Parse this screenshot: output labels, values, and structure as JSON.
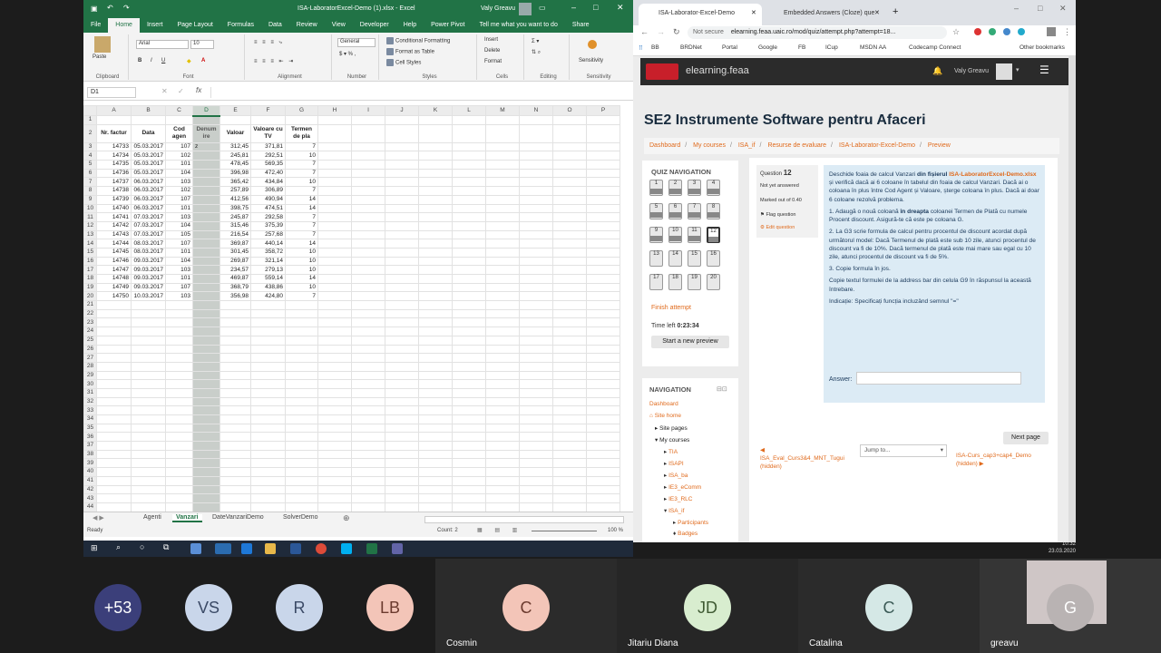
{
  "excel": {
    "title": "ISA-LaboratorExcel-Demo (1).xlsx - Excel",
    "user": "Valy Greavu",
    "tabs": [
      "File",
      "Home",
      "Insert",
      "Page Layout",
      "Formulas",
      "Data",
      "Review",
      "View",
      "Developer",
      "Help",
      "Power Pivot",
      "Tell me what you want to do",
      "Share"
    ],
    "ribbon": {
      "paste": "Paste",
      "clipboard": "Clipboard",
      "font_name": "Arial",
      "font_size": "10",
      "font": "Font",
      "alignment": "Alignment",
      "number_format": "General",
      "number": "Number",
      "cond_fmt": "Conditional Formatting",
      "fmt_table": "Format as Table",
      "cell_styles": "Cell Styles",
      "styles": "Styles",
      "insert": "Insert",
      "delete": "Delete",
      "format": "Format",
      "cells": "Cells",
      "editing": "Editing",
      "sensitivity": "Sensitivity"
    },
    "name_box": "D1",
    "col_headers": [
      "A",
      "B",
      "C",
      "D",
      "E",
      "F",
      "G",
      "H",
      "I",
      "J",
      "K",
      "L",
      "M",
      "N",
      "O",
      "P"
    ],
    "header_row": [
      "Nr. factur",
      "Data",
      "Cod agen",
      "Denum ire",
      "Valoar",
      "Valoare cu TV",
      "Termen de pla"
    ],
    "rows": [
      [
        "14733",
        "05.03.2017",
        "107",
        "z",
        "312,45",
        "371,81",
        "7"
      ],
      [
        "14734",
        "05.03.2017",
        "102",
        "",
        "245,81",
        "292,51",
        "10"
      ],
      [
        "14735",
        "05.03.2017",
        "101",
        "",
        "478,45",
        "569,35",
        "7"
      ],
      [
        "14736",
        "05.03.2017",
        "104",
        "",
        "396,98",
        "472,40",
        "7"
      ],
      [
        "14737",
        "06.03.2017",
        "103",
        "",
        "365,42",
        "434,84",
        "10"
      ],
      [
        "14738",
        "06.03.2017",
        "102",
        "",
        "257,89",
        "306,89",
        "7"
      ],
      [
        "14739",
        "06.03.2017",
        "107",
        "",
        "412,56",
        "490,94",
        "14"
      ],
      [
        "14740",
        "06.03.2017",
        "101",
        "",
        "398,75",
        "474,51",
        "14"
      ],
      [
        "14741",
        "07.03.2017",
        "103",
        "",
        "245,87",
        "292,58",
        "7"
      ],
      [
        "14742",
        "07.03.2017",
        "104",
        "",
        "315,46",
        "375,39",
        "7"
      ],
      [
        "14743",
        "07.03.2017",
        "105",
        "",
        "216,54",
        "257,68",
        "7"
      ],
      [
        "14744",
        "08.03.2017",
        "107",
        "",
        "369,87",
        "440,14",
        "14"
      ],
      [
        "14745",
        "08.03.2017",
        "101",
        "",
        "301,45",
        "358,72",
        "10"
      ],
      [
        "14746",
        "09.03.2017",
        "104",
        "",
        "269,87",
        "321,14",
        "10"
      ],
      [
        "14747",
        "09.03.2017",
        "103",
        "",
        "234,57",
        "279,13",
        "10"
      ],
      [
        "14748",
        "09.03.2017",
        "101",
        "",
        "469,87",
        "559,14",
        "14"
      ],
      [
        "14749",
        "09.03.2017",
        "107",
        "",
        "368,79",
        "438,86",
        "10"
      ],
      [
        "14750",
        "10.03.2017",
        "103",
        "",
        "356,98",
        "424,80",
        "7"
      ]
    ],
    "sheets": [
      "Agenti",
      "Vanzari",
      "DateVanzariDemo",
      "SolverDemo"
    ],
    "active_sheet": "Vanzari",
    "status_ready": "Ready",
    "status_count": "Count: 2",
    "zoom": "100 %"
  },
  "browser": {
    "tabs": [
      "ISA-Laborator-Excel-Demo",
      "Embedded Answers (Cloze) que"
    ],
    "not_secure": "Not secure",
    "url": "elearning.feaa.uaic.ro/mod/quiz/attempt.php?attempt=18...",
    "bookmarks": [
      "BB",
      "BRDNet",
      "Portal",
      "Google",
      "FB",
      "ICup",
      "MSDN AA",
      "Codecamp Connect",
      "Other bookmarks"
    ]
  },
  "moodle": {
    "site": "elearning.feaa",
    "user": "Valy Greavu",
    "heading": "SE2 Instrumente Software pentru Afaceri",
    "breadcrumb": [
      "Dashboard",
      "My courses",
      "ISA_if",
      "Resurse de evaluare",
      "ISA-Laborator-Excel-Demo",
      "Preview"
    ],
    "quiz_nav_title": "QUIZ NAVIGATION",
    "quiz_numbers": [
      "1",
      "2",
      "3",
      "4",
      "5",
      "6",
      "7",
      "8",
      "9",
      "10",
      "11",
      "12",
      "13",
      "14",
      "15",
      "16",
      "17",
      "18",
      "19",
      "20"
    ],
    "finish": "Finish attempt",
    "time_left_label": "Time left",
    "time_left": "0:23:34",
    "new_preview": "Start a new preview",
    "question_label": "Question",
    "question_num": "12",
    "not_answered": "Not yet answered",
    "marked": "Marked out of 0.40",
    "flag": "Flag question",
    "edit": "Edit question",
    "q_p1a": "Deschide foaia de calcul Vanzari ",
    "q_p1b": "din fișierul",
    "q_p1c": " ISA-LaboratorExcel-Demo.xlsx",
    "q_p1d": " și verifică dacă ai 6 coloane în tabelul din foaia de calcul Vanzari. Dacă ai o coloana în plus între Cod Agent și Valoare, șterge coloana în plus. Dacă ai doar 6 coloane rezolvă problema.",
    "q_p2a": "1. Adaugă o nouă coloană ",
    "q_p2b": "în dreapta",
    "q_p2c": " coloanei Termen de Plată cu numele Procent discount. Asigură-te că este pe coloana G.",
    "q_p3": "2. La G3 scrie formula de calcul pentru procentul de discount acordat după următorul model: Dacă Termenul de plată este sub 10 zile, atunci procentul de discount va fi de 10%. Dacă termenul de plată este mai mare sau egal cu 10 zile, atunci procentul de discount va fi de 5%.",
    "q_p4": "3. Copie formula în jos.",
    "q_p5": "Copie textul formulei de la address bar din celula G9 în răspunsul la această întrebare.",
    "q_p6": "Indicație: Specificați funcția incluzând semnul \"=\"",
    "answer_label": "Answer:",
    "next_page": "Next page",
    "jump_to": "Jump to...",
    "prev_link": "ISA_Eval_Curs3&4_MNT_Tugui (hidden)",
    "next_link": "ISA-Curs_cap3+cap4_Demo (hidden)",
    "navigation_title": "NAVIGATION",
    "nav_items": [
      "Dashboard",
      "Site home",
      "Site pages",
      "My courses",
      "TIA",
      "ISAPI",
      "ISA_ba",
      "IE3_eComm",
      "IE3_RLC",
      "ISA_if",
      "Participants",
      "Badges"
    ]
  },
  "clock": {
    "time": "10:32",
    "date": "23.03.2020"
  },
  "participants": [
    {
      "initials": "+53",
      "name": "",
      "color": "#3b3f7a",
      "fg": "#ffffff"
    },
    {
      "initials": "VS",
      "name": "",
      "color": "#c9d6ea",
      "fg": "#3b4a66"
    },
    {
      "initials": "R",
      "name": "",
      "color": "#c9d6ea",
      "fg": "#3b4a66"
    },
    {
      "initials": "LB",
      "name": "",
      "color": "#f3c5b8",
      "fg": "#6b3a2e"
    },
    {
      "initials": "C",
      "name": "Cosmin",
      "color": "#f3c5b8",
      "fg": "#6b3a2e"
    },
    {
      "initials": "JD",
      "name": "Jitariu Diana",
      "color": "#d8edcf",
      "fg": "#3f5a33"
    },
    {
      "initials": "C",
      "name": "Catalina",
      "color": "#d5e8e6",
      "fg": "#3b5a56"
    },
    {
      "initials": "G",
      "name": "greavu",
      "color": "#b9b3b3",
      "fg": "#ffffff"
    }
  ]
}
